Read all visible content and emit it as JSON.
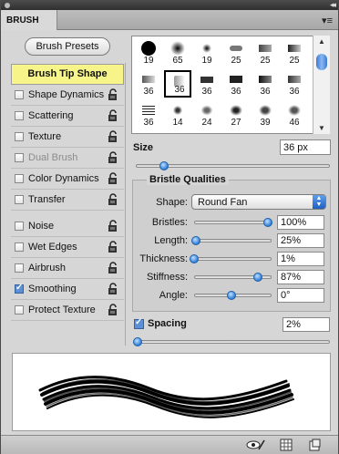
{
  "panel": {
    "tab_label": "BRUSH"
  },
  "left": {
    "presets_label": "Brush Presets",
    "tip_shape_label": "Brush Tip Shape",
    "options": [
      {
        "label": "Shape Dynamics",
        "checked": false
      },
      {
        "label": "Scattering",
        "checked": false
      },
      {
        "label": "Texture",
        "checked": false
      },
      {
        "label": "Dual Brush",
        "checked": false,
        "disabled": true
      },
      {
        "label": "Color Dynamics",
        "checked": false
      },
      {
        "label": "Transfer",
        "checked": false
      },
      {
        "label": "Noise",
        "checked": false
      },
      {
        "label": "Wet Edges",
        "checked": false
      },
      {
        "label": "Airbrush",
        "checked": false
      },
      {
        "label": "Smoothing",
        "checked": true
      },
      {
        "label": "Protect Texture",
        "checked": false
      }
    ]
  },
  "brushes": {
    "rows": [
      [
        "19",
        "65",
        "19",
        "25",
        "25",
        "25"
      ],
      [
        "36",
        "36",
        "36",
        "36",
        "36",
        "36"
      ],
      [
        "36",
        "14",
        "24",
        "27",
        "39",
        "46"
      ]
    ],
    "selected": "36"
  },
  "size": {
    "label": "Size",
    "value": "36 px",
    "level": 0.13
  },
  "bristle": {
    "title": "Bristle Qualities",
    "shape_label": "Shape:",
    "shape_value": "Round Fan",
    "params": [
      {
        "label": "Bristles:",
        "value": "100%",
        "level": 1.0
      },
      {
        "label": "Length:",
        "value": "25%",
        "level": 0.02
      },
      {
        "label": "Thickness:",
        "value": "1%",
        "level": 0.0
      },
      {
        "label": "Stiffness:",
        "value": "87%",
        "level": 0.87
      },
      {
        "label": "Angle:",
        "value": "0°",
        "level": 0.5
      }
    ]
  },
  "spacing": {
    "label": "Spacing",
    "value": "2%",
    "checked": true,
    "level": 0.0
  },
  "icons": {
    "lock": "lock-icon",
    "close": "close-icon",
    "panel_menu": "panel-menu-icon",
    "eye": "bristle-preview-toggle-icon",
    "grid": "brush-grid-icon",
    "new": "new-preset-icon"
  }
}
